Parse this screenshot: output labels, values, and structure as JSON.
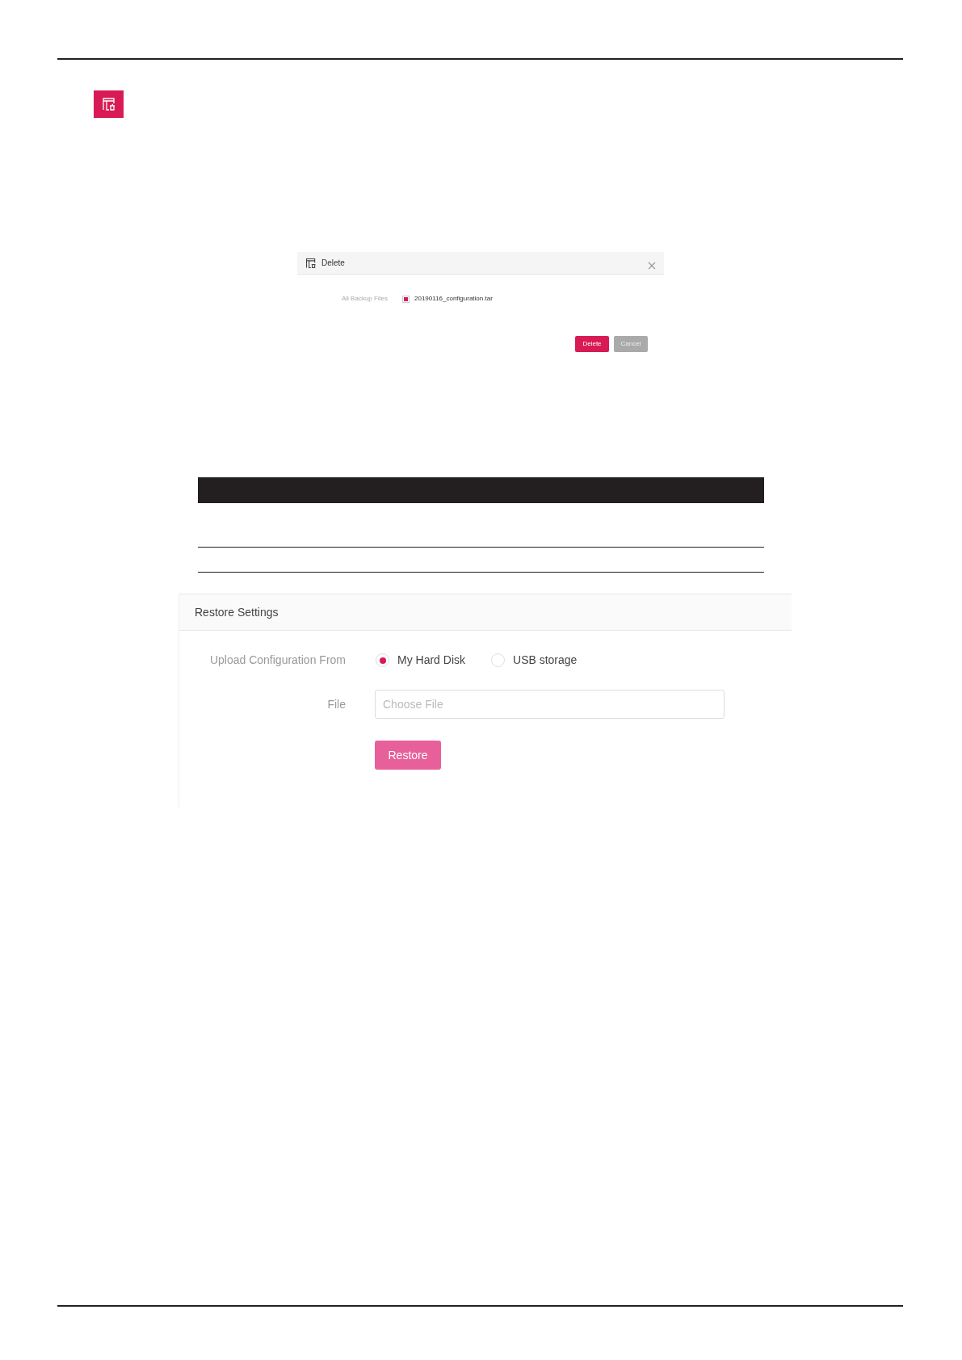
{
  "delete_dialog": {
    "title": "Delete",
    "field_label": "All Backup Files",
    "files": [
      {
        "name": "20190116_configuration.tar",
        "checked": true
      }
    ],
    "buttons": [
      {
        "label": "Delete",
        "kind": "primary"
      },
      {
        "label": "Cancel",
        "kind": "secondary"
      }
    ]
  },
  "restore_panel": {
    "title": "Restore Settings",
    "source_label": "Upload Configuration From",
    "sources": [
      {
        "label": "My Hard Disk",
        "selected": true
      },
      {
        "label": "USB storage",
        "selected": false
      }
    ],
    "file_label": "File",
    "file_field": {
      "placeholder": "Choose File"
    },
    "button": "Restore"
  }
}
